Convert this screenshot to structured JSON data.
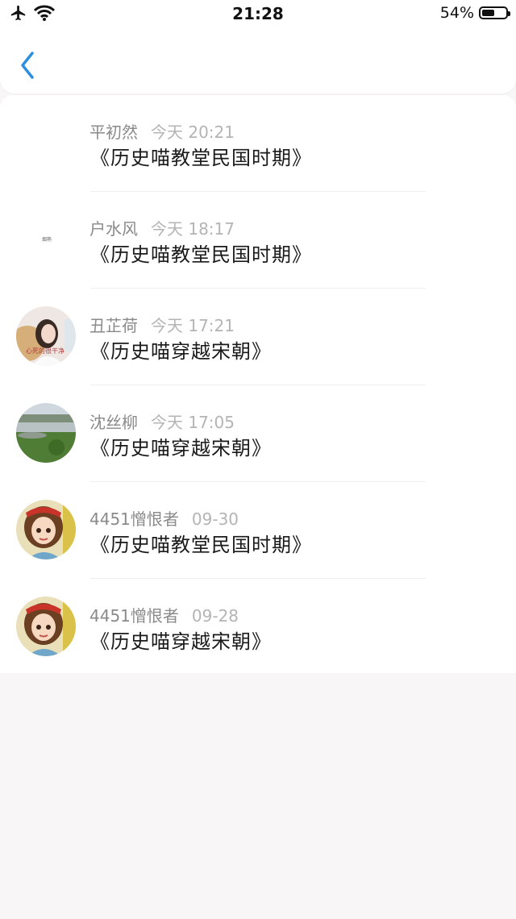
{
  "status_bar": {
    "time": "21:28",
    "battery_text": "54%",
    "battery_level": 0.54,
    "icons": [
      "airplane-icon",
      "wifi-icon",
      "battery-icon"
    ]
  },
  "nav": {
    "back_icon": "chevron-left-icon",
    "accent_color": "#2d8fe0"
  },
  "comments": [
    {
      "user": "平初然",
      "time": "今天 20:21",
      "title": "《历史喵教堂民国时期》",
      "avatar": "none",
      "avatar_text": ""
    },
    {
      "user": "户水风",
      "time": "今天 18:17",
      "title": "《历史喵教堂民国时期》",
      "avatar": "text",
      "avatar_text": "烟熟"
    },
    {
      "user": "丑芷荷",
      "time": "今天 17:21",
      "title": "《历史喵穿越宋朝》",
      "avatar": "girl-photo",
      "avatar_text": "心死的很干净"
    },
    {
      "user": "沈丝柳",
      "time": "今天 17:05",
      "title": "《历史喵穿越宋朝》",
      "avatar": "landscape-photo",
      "avatar_text": ""
    },
    {
      "user": "4451憎恨者",
      "time": "09-30",
      "title": "《历史喵教堂民国时期》",
      "avatar": "cartoon-girl",
      "avatar_text": ""
    },
    {
      "user": "4451憎恨者",
      "time": "09-28",
      "title": "《历史喵穿越宋朝》",
      "avatar": "cartoon-girl",
      "avatar_text": ""
    }
  ]
}
